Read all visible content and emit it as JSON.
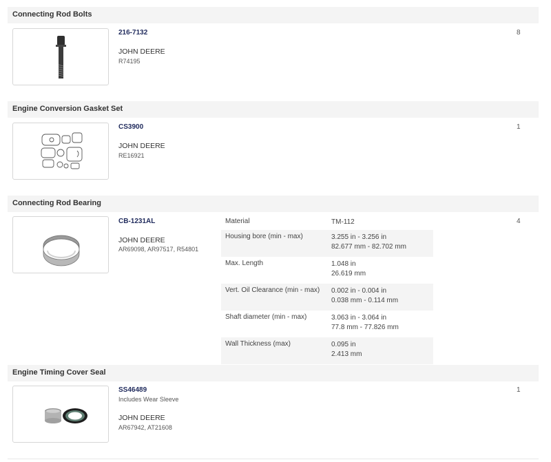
{
  "parts": [
    {
      "category": "Connecting Rod Bolts",
      "part_number": "216-7132",
      "brand": "JOHN DEERE",
      "oem_numbers": "R74195",
      "quantity": "8",
      "image": "bolt-image"
    },
    {
      "category": "Engine Conversion Gasket Set",
      "part_number": "CS3900",
      "brand": "JOHN DEERE",
      "oem_numbers": "RE16921",
      "quantity": "1",
      "image": "gasket-set-image"
    },
    {
      "category": "Connecting Rod Bearing",
      "part_number": "CB-1231AL",
      "brand": "JOHN DEERE",
      "oem_numbers": "AR69098, AR97517, R54801",
      "quantity": "4",
      "image": "bearing-image",
      "specs": [
        {
          "name": "Material",
          "value_1": "TM-112",
          "value_2": ""
        },
        {
          "name": "Housing bore (min - max)",
          "value_1": "3.255 in - 3.256 in",
          "value_2": "82.677 mm - 82.702 mm"
        },
        {
          "name": "Max. Length",
          "value_1": "1.048 in",
          "value_2": "26.619 mm"
        },
        {
          "name": "Vert. Oil Clearance (min - max)",
          "value_1": "0.002 in - 0.004 in",
          "value_2": "0.038 mm - 0.114 mm"
        },
        {
          "name": "Shaft diameter (min - max)",
          "value_1": "3.063 in - 3.064 in",
          "value_2": "77.8 mm - 77.826 mm"
        },
        {
          "name": "Wall Thickness (max)",
          "value_1": "0.095 in",
          "value_2": "2.413 mm"
        }
      ]
    },
    {
      "category": "Engine Timing Cover Seal",
      "part_number": "SS46489",
      "note": "Includes Wear Sleeve",
      "brand": "JOHN DEERE",
      "oem_numbers": "AR67942, AT21608",
      "quantity": "1",
      "image": "seal-and-sleeve-image"
    }
  ]
}
